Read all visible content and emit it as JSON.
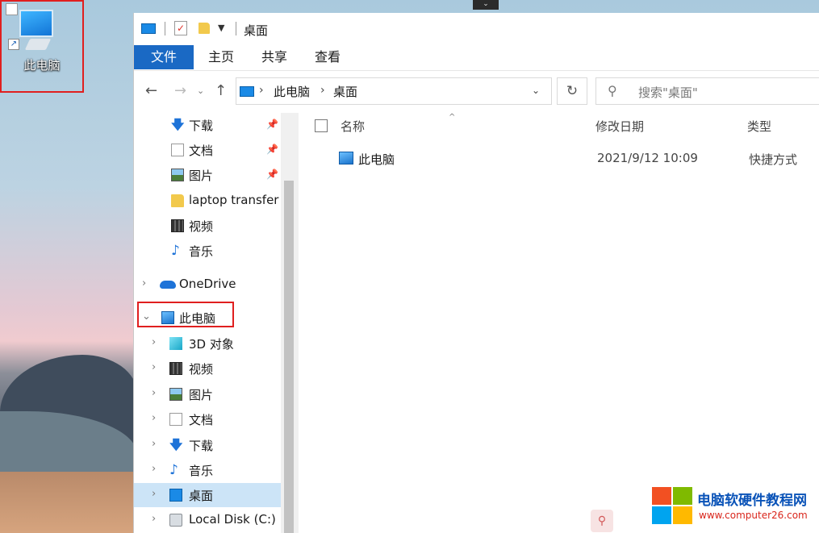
{
  "desktop": {
    "icon_label": "此电脑"
  },
  "window": {
    "title": "桌面",
    "ribbon_tabs": [
      {
        "label": "文件"
      },
      {
        "label": "主页"
      },
      {
        "label": "共享"
      },
      {
        "label": "查看"
      }
    ],
    "address": {
      "crumbs": [
        "此电脑",
        "桌面"
      ]
    },
    "search": {
      "placeholder": "搜索\"桌面\""
    }
  },
  "nav": {
    "quick_access": [
      {
        "label": "下载",
        "icon": "download-icon",
        "pinned": true
      },
      {
        "label": "文档",
        "icon": "document-icon",
        "pinned": true
      },
      {
        "label": "图片",
        "icon": "pictures-icon",
        "pinned": true
      },
      {
        "label": "laptop transfer",
        "icon": "folder-icon",
        "pinned": false
      },
      {
        "label": "视频",
        "icon": "video-icon",
        "pinned": false
      },
      {
        "label": "音乐",
        "icon": "music-icon",
        "pinned": false
      }
    ],
    "onedrive": "OneDrive",
    "this_pc": "此电脑",
    "this_pc_children": [
      {
        "label": "3D 对象",
        "icon": "3d-objects-icon"
      },
      {
        "label": "视频",
        "icon": "video-icon"
      },
      {
        "label": "图片",
        "icon": "pictures-icon"
      },
      {
        "label": "文档",
        "icon": "document-icon"
      },
      {
        "label": "下载",
        "icon": "download-icon"
      },
      {
        "label": "音乐",
        "icon": "music-icon"
      },
      {
        "label": "桌面",
        "icon": "desktop-icon",
        "selected": true
      },
      {
        "label": "Local Disk (C:)",
        "icon": "disk-icon"
      }
    ]
  },
  "content": {
    "columns": [
      "名称",
      "修改日期",
      "类型"
    ],
    "rows": [
      {
        "name": "此电脑",
        "date": "2021/9/12 10:09",
        "type": "快捷方式"
      }
    ]
  },
  "watermark": {
    "title": "电脑软硬件教程网",
    "url": "www.computer26.com"
  },
  "colors": {
    "accent": "#1a69c4",
    "highlight": "#e01f1f",
    "selected": "#cce4f7"
  }
}
